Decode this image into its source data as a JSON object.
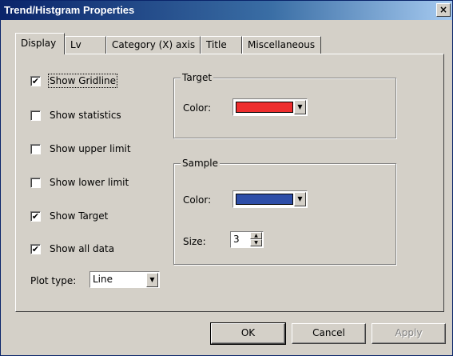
{
  "window": {
    "title": "Trend/Histgram Properties",
    "close_label": "×"
  },
  "tabs": [
    {
      "label": "Display"
    },
    {
      "label": "Lv"
    },
    {
      "label": "Category (X) axis"
    },
    {
      "label": "Title"
    },
    {
      "label": "Miscellaneous"
    }
  ],
  "active_tab": "Display",
  "display": {
    "checkboxes": [
      {
        "label": "Show Gridline",
        "checked": true,
        "mark": "✔"
      },
      {
        "label": "Show statistics",
        "checked": false,
        "mark": ""
      },
      {
        "label": "Show upper limit",
        "checked": false,
        "mark": ""
      },
      {
        "label": "Show lower limit",
        "checked": false,
        "mark": ""
      },
      {
        "label": "Show Target",
        "checked": true,
        "mark": "✔"
      },
      {
        "label": "Show all data",
        "checked": true,
        "mark": "✔"
      }
    ],
    "plot_type": {
      "label": "Plot type:",
      "value": "Line",
      "arrow": "▼"
    },
    "target_group": {
      "title": "Target",
      "color_label": "Color:",
      "color": "#ee2e2e",
      "arrow": "▼"
    },
    "sample_group": {
      "title": "Sample",
      "color_label": "Color:",
      "color": "#2e4ea8",
      "arrow": "▼",
      "size_label": "Size:",
      "size_value": "3",
      "spin_up": "▲",
      "spin_down": "▼"
    }
  },
  "buttons": {
    "ok": "OK",
    "cancel": "Cancel",
    "apply": "Apply"
  }
}
